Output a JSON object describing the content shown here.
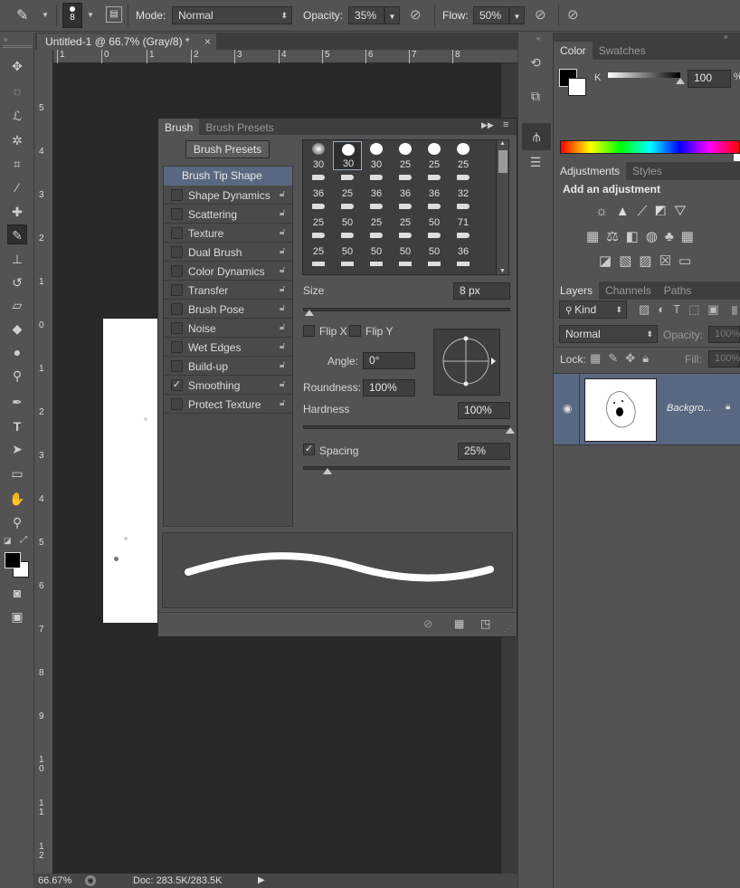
{
  "options_bar": {
    "brush_size": "8",
    "mode_label": "Mode:",
    "mode_value": "Normal",
    "opacity_label": "Opacity:",
    "opacity_value": "35%",
    "flow_label": "Flow:",
    "flow_value": "50%"
  },
  "document": {
    "tab_title": "Untitled-1 @ 66.7% (Gray/8) *",
    "close_glyph": "×",
    "ruler_h": [
      "1",
      "0",
      "1",
      "2",
      "3",
      "4",
      "5",
      "6",
      "7",
      "8"
    ],
    "ruler_v": [
      "5",
      "4",
      "3",
      "2",
      "1",
      "0",
      "1",
      "2",
      "3",
      "4",
      "5",
      "6",
      "7",
      "8",
      "9",
      "1\n0",
      "1\n1",
      "1\n2"
    ],
    "zoom": "66.67%",
    "doc_info": "Doc: 283.5K/283.5K"
  },
  "brush_panel": {
    "tabs": [
      "Brush",
      "Brush Presets"
    ],
    "presets_button": "Brush Presets",
    "tip_shape": "Brush Tip Shape",
    "items": [
      {
        "label": "Shape Dynamics",
        "checked": false
      },
      {
        "label": "Scattering",
        "checked": false
      },
      {
        "label": "Texture",
        "checked": false
      },
      {
        "label": "Dual Brush",
        "checked": false
      },
      {
        "label": "Color Dynamics",
        "checked": false
      },
      {
        "label": "Transfer",
        "checked": false
      },
      {
        "label": "Brush Pose",
        "checked": false
      },
      {
        "label": "Noise",
        "checked": false
      },
      {
        "label": "Wet Edges",
        "checked": false
      },
      {
        "label": "Build-up",
        "checked": false
      },
      {
        "label": "Smoothing",
        "checked": true
      },
      {
        "label": "Protect Texture",
        "checked": false
      }
    ],
    "tip_grid": [
      [
        "30",
        "30",
        "30",
        "25",
        "25",
        "25"
      ],
      [
        "36",
        "25",
        "36",
        "36",
        "36",
        "32"
      ],
      [
        "25",
        "50",
        "25",
        "25",
        "50",
        "71"
      ],
      [
        "25",
        "50",
        "50",
        "50",
        "50",
        "36"
      ]
    ],
    "size_label": "Size",
    "size_value": "8 px",
    "flip_x": "Flip X",
    "flip_y": "Flip Y",
    "angle_label": "Angle:",
    "angle_value": "0°",
    "roundness_label": "Roundness:",
    "roundness_value": "100%",
    "hardness_label": "Hardness",
    "hardness_value": "100%",
    "spacing_label": "Spacing",
    "spacing_value": "25%",
    "spacing_checked": true
  },
  "color_panel": {
    "tabs": [
      "Color",
      "Swatches"
    ],
    "channel": "K",
    "value": "100",
    "unit": "%"
  },
  "adjustments_panel": {
    "tabs": [
      "Adjustments",
      "Styles"
    ],
    "heading": "Add an adjustment"
  },
  "layers_panel": {
    "tabs": [
      "Layers",
      "Channels",
      "Paths"
    ],
    "kind": "Kind",
    "blend_mode": "Normal",
    "opacity_label": "Opacity:",
    "opacity_value": "100%",
    "lock_label": "Lock:",
    "fill_label": "Fill:",
    "fill_value": "100%",
    "layer_name": "Backgro..."
  }
}
